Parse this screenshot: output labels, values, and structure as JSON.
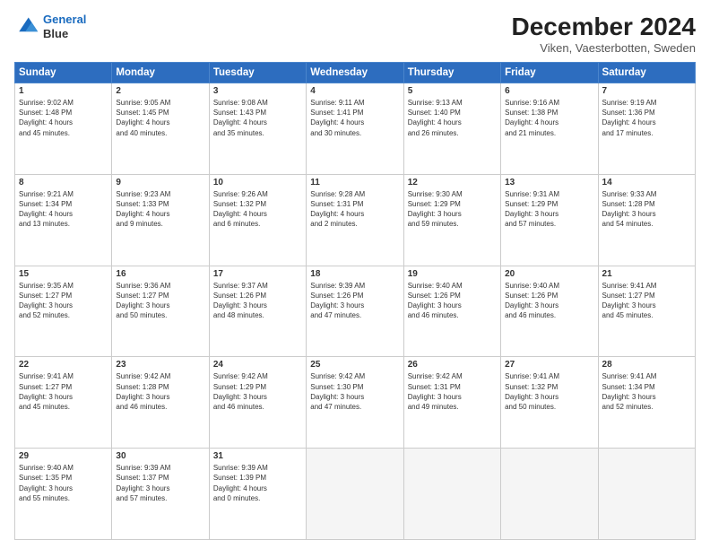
{
  "logo": {
    "line1": "General",
    "line2": "Blue"
  },
  "title": "December 2024",
  "subtitle": "Viken, Vaesterbotten, Sweden",
  "header_days": [
    "Sunday",
    "Monday",
    "Tuesday",
    "Wednesday",
    "Thursday",
    "Friday",
    "Saturday"
  ],
  "weeks": [
    [
      {
        "day": "1",
        "info": "Sunrise: 9:02 AM\nSunset: 1:48 PM\nDaylight: 4 hours\nand 45 minutes."
      },
      {
        "day": "2",
        "info": "Sunrise: 9:05 AM\nSunset: 1:45 PM\nDaylight: 4 hours\nand 40 minutes."
      },
      {
        "day": "3",
        "info": "Sunrise: 9:08 AM\nSunset: 1:43 PM\nDaylight: 4 hours\nand 35 minutes."
      },
      {
        "day": "4",
        "info": "Sunrise: 9:11 AM\nSunset: 1:41 PM\nDaylight: 4 hours\nand 30 minutes."
      },
      {
        "day": "5",
        "info": "Sunrise: 9:13 AM\nSunset: 1:40 PM\nDaylight: 4 hours\nand 26 minutes."
      },
      {
        "day": "6",
        "info": "Sunrise: 9:16 AM\nSunset: 1:38 PM\nDaylight: 4 hours\nand 21 minutes."
      },
      {
        "day": "7",
        "info": "Sunrise: 9:19 AM\nSunset: 1:36 PM\nDaylight: 4 hours\nand 17 minutes."
      }
    ],
    [
      {
        "day": "8",
        "info": "Sunrise: 9:21 AM\nSunset: 1:34 PM\nDaylight: 4 hours\nand 13 minutes."
      },
      {
        "day": "9",
        "info": "Sunrise: 9:23 AM\nSunset: 1:33 PM\nDaylight: 4 hours\nand 9 minutes."
      },
      {
        "day": "10",
        "info": "Sunrise: 9:26 AM\nSunset: 1:32 PM\nDaylight: 4 hours\nand 6 minutes."
      },
      {
        "day": "11",
        "info": "Sunrise: 9:28 AM\nSunset: 1:31 PM\nDaylight: 4 hours\nand 2 minutes."
      },
      {
        "day": "12",
        "info": "Sunrise: 9:30 AM\nSunset: 1:29 PM\nDaylight: 3 hours\nand 59 minutes."
      },
      {
        "day": "13",
        "info": "Sunrise: 9:31 AM\nSunset: 1:29 PM\nDaylight: 3 hours\nand 57 minutes."
      },
      {
        "day": "14",
        "info": "Sunrise: 9:33 AM\nSunset: 1:28 PM\nDaylight: 3 hours\nand 54 minutes."
      }
    ],
    [
      {
        "day": "15",
        "info": "Sunrise: 9:35 AM\nSunset: 1:27 PM\nDaylight: 3 hours\nand 52 minutes."
      },
      {
        "day": "16",
        "info": "Sunrise: 9:36 AM\nSunset: 1:27 PM\nDaylight: 3 hours\nand 50 minutes."
      },
      {
        "day": "17",
        "info": "Sunrise: 9:37 AM\nSunset: 1:26 PM\nDaylight: 3 hours\nand 48 minutes."
      },
      {
        "day": "18",
        "info": "Sunrise: 9:39 AM\nSunset: 1:26 PM\nDaylight: 3 hours\nand 47 minutes."
      },
      {
        "day": "19",
        "info": "Sunrise: 9:40 AM\nSunset: 1:26 PM\nDaylight: 3 hours\nand 46 minutes."
      },
      {
        "day": "20",
        "info": "Sunrise: 9:40 AM\nSunset: 1:26 PM\nDaylight: 3 hours\nand 46 minutes."
      },
      {
        "day": "21",
        "info": "Sunrise: 9:41 AM\nSunset: 1:27 PM\nDaylight: 3 hours\nand 45 minutes."
      }
    ],
    [
      {
        "day": "22",
        "info": "Sunrise: 9:41 AM\nSunset: 1:27 PM\nDaylight: 3 hours\nand 45 minutes."
      },
      {
        "day": "23",
        "info": "Sunrise: 9:42 AM\nSunset: 1:28 PM\nDaylight: 3 hours\nand 46 minutes."
      },
      {
        "day": "24",
        "info": "Sunrise: 9:42 AM\nSunset: 1:29 PM\nDaylight: 3 hours\nand 46 minutes."
      },
      {
        "day": "25",
        "info": "Sunrise: 9:42 AM\nSunset: 1:30 PM\nDaylight: 3 hours\nand 47 minutes."
      },
      {
        "day": "26",
        "info": "Sunrise: 9:42 AM\nSunset: 1:31 PM\nDaylight: 3 hours\nand 49 minutes."
      },
      {
        "day": "27",
        "info": "Sunrise: 9:41 AM\nSunset: 1:32 PM\nDaylight: 3 hours\nand 50 minutes."
      },
      {
        "day": "28",
        "info": "Sunrise: 9:41 AM\nSunset: 1:34 PM\nDaylight: 3 hours\nand 52 minutes."
      }
    ],
    [
      {
        "day": "29",
        "info": "Sunrise: 9:40 AM\nSunset: 1:35 PM\nDaylight: 3 hours\nand 55 minutes."
      },
      {
        "day": "30",
        "info": "Sunrise: 9:39 AM\nSunset: 1:37 PM\nDaylight: 3 hours\nand 57 minutes."
      },
      {
        "day": "31",
        "info": "Sunrise: 9:39 AM\nSunset: 1:39 PM\nDaylight: 4 hours\nand 0 minutes."
      },
      null,
      null,
      null,
      null
    ]
  ]
}
